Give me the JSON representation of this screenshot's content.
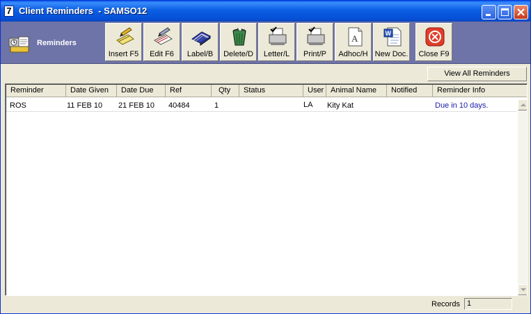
{
  "window": {
    "title": "Client Reminders  - SAMSO12",
    "app_icon_text": "7"
  },
  "toolbar": {
    "section_label": "Reminders",
    "buttons": [
      {
        "label": "Insert F5",
        "icon": "insert-icon"
      },
      {
        "label": "Edit F6",
        "icon": "edit-icon"
      },
      {
        "label": "Label/B",
        "icon": "label-icon"
      },
      {
        "label": "Delete/D",
        "icon": "delete-icon"
      },
      {
        "label": "Letter/L",
        "icon": "letter-icon"
      },
      {
        "label": "Print/P",
        "icon": "print-icon"
      },
      {
        "label": "Adhoc/H",
        "icon": "adhoc-icon"
      },
      {
        "label": "New Doc.",
        "icon": "new-doc-icon"
      },
      {
        "label": "Close F9",
        "icon": "close-icon"
      }
    ]
  },
  "view_all_label": "View All Reminders",
  "table": {
    "columns": [
      "Reminder",
      "Date Given",
      "Date Due",
      "Ref",
      "Qty",
      "Status",
      "User",
      "Animal Name",
      "Notified",
      "Reminder Info"
    ],
    "rows": [
      {
        "reminder": "ROS",
        "date_given": "11 FEB 10",
        "date_due": "21 FEB 10",
        "ref": "40484",
        "qty": "1",
        "status": "",
        "user": "LA",
        "animal_name": "Kity Kat",
        "notified": "",
        "reminder_info": "Due in 10 days."
      }
    ]
  },
  "footer": {
    "records_label": "Records",
    "records_value": "1"
  },
  "colors": {
    "title_blue": "#0a5fe9",
    "toolbar_bg": "#6e73a8",
    "info_text": "#1a1aa8",
    "close_red": "#e03c2a"
  }
}
